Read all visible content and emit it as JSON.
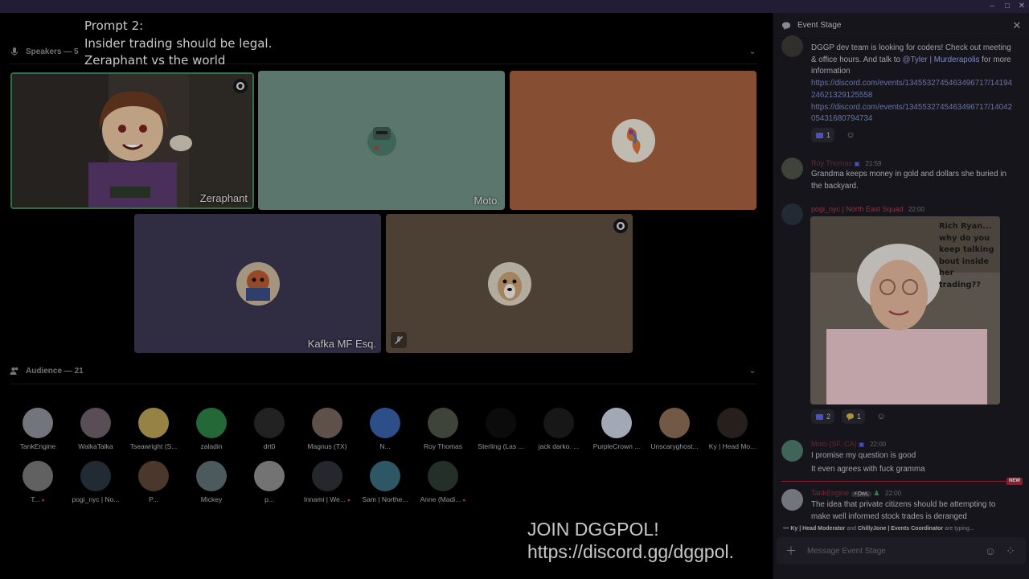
{
  "window": {
    "minimize": "‒",
    "maximize": "□",
    "close": "✕"
  },
  "overlay": {
    "line1": "Prompt 2:",
    "line2": "Insider trading should be legal.",
    "line3": "Zeraphant vs the world"
  },
  "speakers_header": {
    "label": "Speakers — 5",
    "icon": "microphone-icon"
  },
  "speakers": [
    {
      "name": "Zeraphant",
      "color": "#5a5048",
      "active": true,
      "badge": "moderator-shield-icon"
    },
    {
      "name": "Moto.",
      "color": "#6f9186"
    },
    {
      "name": "",
      "color": "#a4603f"
    },
    {
      "name": "Kafka MF Esq.",
      "color": "#3b3651"
    },
    {
      "name": "",
      "color": "#5d4e3f",
      "badge": "moderator-shield-icon",
      "muted": true
    }
  ],
  "audience_header": {
    "label": "Audience — 21",
    "icon": "people-icon"
  },
  "audience": [
    {
      "name": "TankEngine",
      "color": "#8b8f96"
    },
    {
      "name": "WalkaTalka",
      "color": "#6d5f69"
    },
    {
      "name": "Tseawright (S...",
      "color": "#b89f54"
    },
    {
      "name": "zaladin",
      "color": "#2d7f45"
    },
    {
      "name": "drt0",
      "color": "#2a2a2a"
    },
    {
      "name": "Magnus (TX)",
      "color": "#73635a"
    },
    {
      "name": "N...",
      "color": "#3760a8"
    },
    {
      "name": "Roy Thomas",
      "color": "#4e5447"
    },
    {
      "name": "Sterling (Las ...",
      "color": "#0e0e0e"
    },
    {
      "name": "jack darko. ...",
      "color": "#1d1d1d"
    },
    {
      "name": "PurpleCrown ...",
      "color": "#c7cde0"
    },
    {
      "name": "Unscaryghost...",
      "color": "#8a6d55"
    },
    {
      "name": "Ky | Head Mo...",
      "color": "#2f2723"
    },
    {
      "name": "T...",
      "color": "#777",
      "dot": true
    },
    {
      "name": "pogi_nyc | No...",
      "color": "#2a3440"
    },
    {
      "name": "P...",
      "color": "#5b4536"
    },
    {
      "name": "Mickey",
      "color": "#5d6e73"
    },
    {
      "name": "p...",
      "color": "#8d8d8d"
    },
    {
      "name": "Innami | We...",
      "color": "#2f2f37",
      "dot": true
    },
    {
      "name": "Sam | Northe...",
      "color": "#3a6a7c"
    },
    {
      "name": "Anne (Madi...",
      "color": "#2d3a33",
      "dot": true
    }
  ],
  "join": {
    "line1": "JOIN DGGPOL!",
    "line2": "https://discord.gg/dggpol."
  },
  "panel": {
    "title": "Event Stage",
    "close": "✕",
    "messages": [
      {
        "text_a": "DGGP dev team is looking for coders! Check out meeting & office hours. And talk to ",
        "mention": "@Tyler | Murderapolis",
        "text_b": " for more information",
        "link1": "https://discord.com/events/1345532745463496717/1419424621329125558",
        "link2": "https://discord.com/events/1345532745463496717/1404205431680794734",
        "reaction_count": "1"
      },
      {
        "author": "Roy Thomas",
        "author_color": "#7a3340",
        "time": "21:59",
        "text": "Grandma keeps money in gold and dollars she buried in the backyard."
      },
      {
        "author": "pogi_nyc | North East Squad",
        "author_color": "#a4434e",
        "time": "22:00",
        "meme_text": "Rich Ryan... why do you keep talking bout inside her trading??",
        "reaction1_count": "2",
        "reaction2_count": "1"
      },
      {
        "author": "Moto (SF, CA)",
        "author_color": "#7a3340",
        "time": "22:00",
        "line1": "I promise my question is good",
        "line2": "It even agrees with fuck gramma"
      },
      {
        "author": "TankEngine",
        "author_color": "#a8283e",
        "tag": "OwL",
        "time": "22:00",
        "text": "The idea that private citizens should be attempting to make well informed stock trades is deranged"
      }
    ],
    "new_badge": "NEW",
    "typing": {
      "user1": "Ky | Head Moderator",
      "mid": " and ",
      "user2": "ChillyJone | Events Coordinator",
      "end": " are typing..."
    },
    "composer_placeholder": "Message Event Stage"
  }
}
